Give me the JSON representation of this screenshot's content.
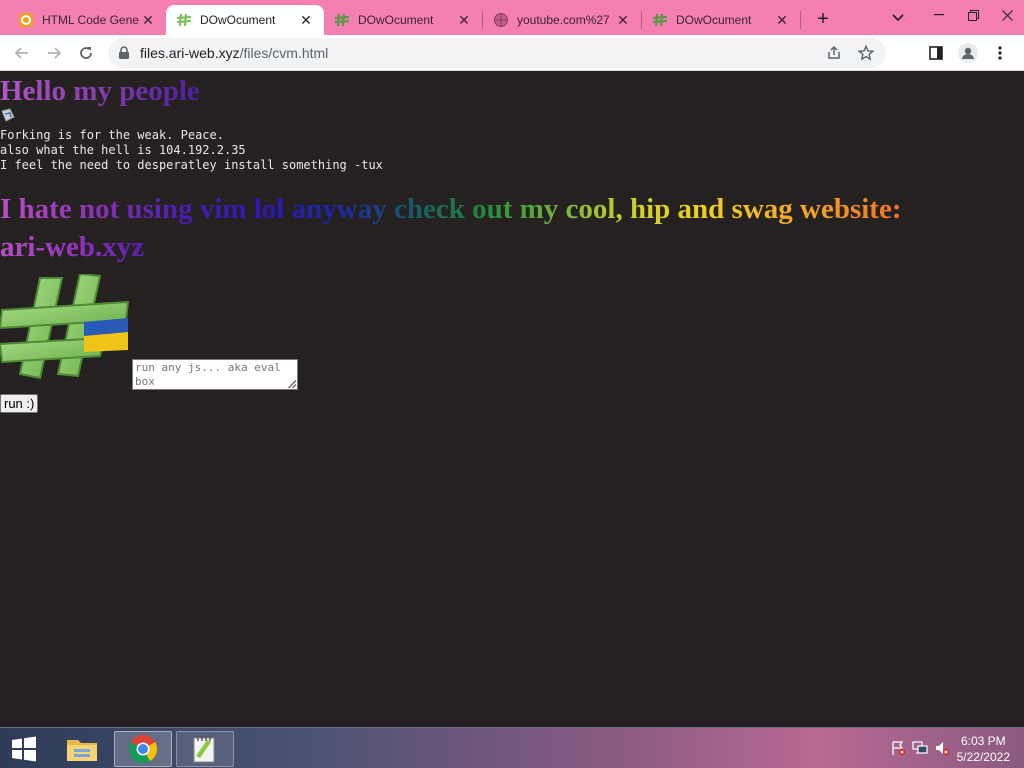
{
  "browser": {
    "tabs": [
      {
        "title": "HTML Code Gene",
        "active": false,
        "favicon": "code-generator-icon"
      },
      {
        "title": "DOwOcument",
        "active": true,
        "favicon": "hashtag-leaf-icon"
      },
      {
        "title": "DOwOcument",
        "active": false,
        "favicon": "hashtag-leaf-icon"
      },
      {
        "title": "youtube.com%27",
        "active": false,
        "favicon": "globe-icon"
      },
      {
        "title": "DOwOcument",
        "active": false,
        "favicon": "hashtag-leaf-icon"
      }
    ],
    "url_host": "files.ari-web.xyz",
    "url_path": "/files/cvm.html",
    "tabstrip_color": "#f57fb0"
  },
  "page": {
    "heading": "Hello my people",
    "text_lines": [
      "Forking is for the weak. Peace.",
      "also what the hell is 104.192.2.35",
      "I feel the need to desperatley install something -tux"
    ],
    "rainbow_line1": "I hate not using vim lol anyway check out my cool, hip and swag website:",
    "rainbow_line2": "ari-web.xyz",
    "eval_placeholder": "run any js... aka eval box",
    "run_button": "run :)",
    "background": "#242120"
  },
  "taskbar": {
    "time": "6:03 PM",
    "date": "5/22/2022"
  }
}
